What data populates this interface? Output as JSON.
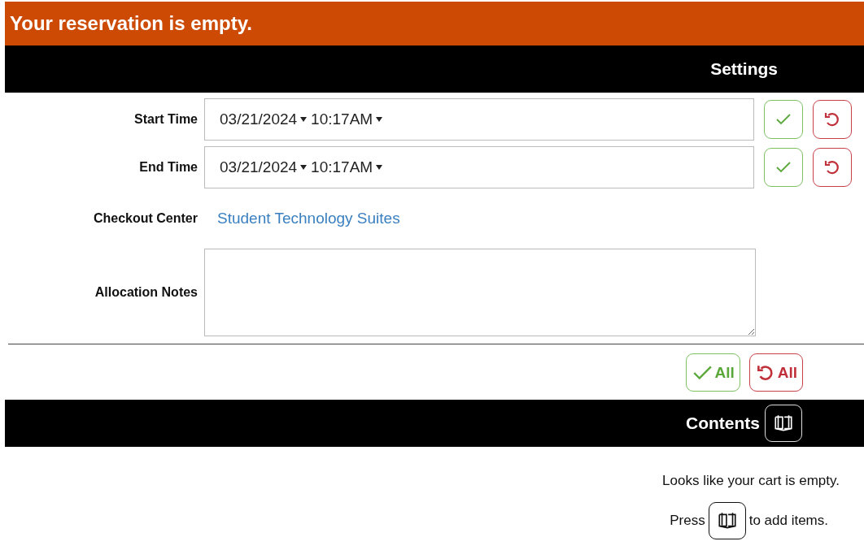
{
  "banner": {
    "title": "Your reservation is empty."
  },
  "settings": {
    "title": "Settings",
    "time_fields": [
      {
        "label": "Start Time",
        "date": "03/21/2024",
        "time": "10:17AM"
      },
      {
        "label": "End Time",
        "date": "03/21/2024",
        "time": "10:17AM"
      }
    ],
    "checkout_center": {
      "label": "Checkout Center",
      "value": "Student Technology Suites"
    },
    "notes": {
      "label": "Allocation Notes"
    },
    "buttons": [
      {
        "kind": "accept",
        "label": "All"
      },
      {
        "kind": "revert",
        "label": "All"
      }
    ]
  },
  "contents": {
    "title": "Contents",
    "empty_message": "Looks like your cart is empty.",
    "hint_before": "Press",
    "hint_after": "to add items."
  }
}
